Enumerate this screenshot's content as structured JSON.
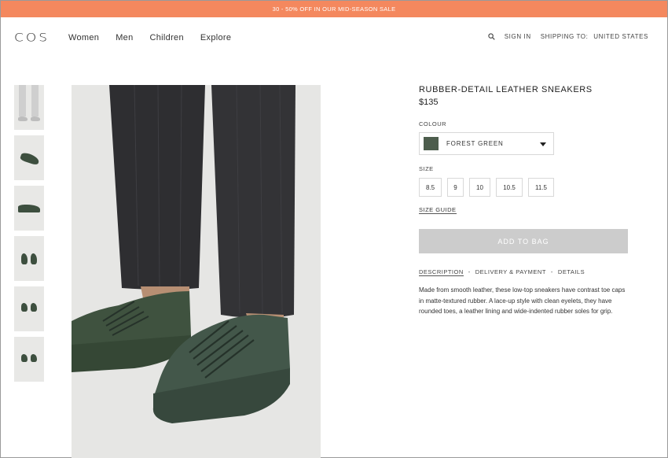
{
  "promo": {
    "text": "30 - 50% OFF IN OUR MID-SEASON SALE"
  },
  "header": {
    "logo": "COS",
    "nav": [
      "Women",
      "Men",
      "Children",
      "Explore"
    ],
    "sign_in": "SIGN IN",
    "shipping_label": "SHIPPING TO:",
    "shipping_country": "UNITED STATES",
    "search_icon": "search-icon"
  },
  "product": {
    "title": "RUBBER-DETAIL LEATHER SNEAKERS",
    "price": "$135",
    "colour_label": "COLOUR",
    "colour_value": "FOREST GREEN",
    "colour_swatch": "#4d5d4d",
    "size_label": "SIZE",
    "sizes": [
      "8.5",
      "9",
      "10",
      "10.5",
      "11.5"
    ],
    "size_guide": "SIZE GUIDE",
    "add_to_bag": "ADD TO BAG",
    "tabs": [
      "DESCRIPTION",
      "DELIVERY & PAYMENT",
      "DETAILS"
    ],
    "description": "Made from smooth leather, these low-top sneakers have contrast toe caps in matte-textured rubber. A lace-up style with clean eyelets, they have rounded toes, a leather lining and wide-indented rubber soles for grip."
  },
  "colors": {
    "promo_bg": "#f4885e",
    "button_disabled": "#cccccc",
    "shoe_green": "#3d4f3f",
    "trousers": "#2f2f31"
  }
}
